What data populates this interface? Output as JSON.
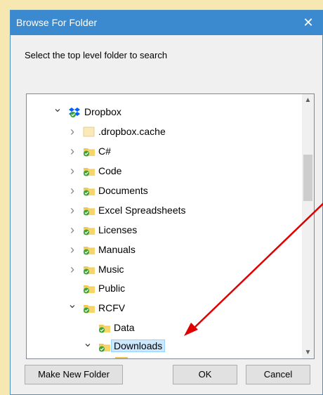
{
  "dialog": {
    "title": "Browse For Folder",
    "close_symbol": "✕",
    "instruction": "Select the top level folder to search"
  },
  "tree": {
    "items": [
      {
        "label": "Dropbox",
        "expander": "expanded",
        "icon": "dropbox-icon"
      },
      {
        "label": ".dropbox.cache",
        "expander": "collapsed",
        "icon": "folder-plain-icon"
      },
      {
        "label": "C#",
        "expander": "collapsed",
        "icon": "folder-synced-icon"
      },
      {
        "label": "Code",
        "expander": "collapsed",
        "icon": "folder-synced-icon"
      },
      {
        "label": "Documents",
        "expander": "collapsed",
        "icon": "folder-synced-icon"
      },
      {
        "label": "Excel Spreadsheets",
        "expander": "collapsed",
        "icon": "folder-synced-icon"
      },
      {
        "label": "Licenses",
        "expander": "collapsed",
        "icon": "folder-synced-icon"
      },
      {
        "label": "Manuals",
        "expander": "collapsed",
        "icon": "folder-synced-icon"
      },
      {
        "label": "Music",
        "expander": "collapsed",
        "icon": "folder-synced-icon"
      },
      {
        "label": "Public",
        "expander": "none",
        "icon": "folder-synced-icon"
      },
      {
        "label": "RCFV",
        "expander": "expanded",
        "icon": "folder-synced-icon"
      },
      {
        "label": "Data",
        "expander": "none",
        "icon": "folder-synced-icon"
      },
      {
        "label": "Downloads",
        "expander": "expanded",
        "icon": "folder-synced-icon",
        "selected": true
      }
    ]
  },
  "buttons": {
    "make_new_folder": "Make New Folder",
    "ok": "OK",
    "cancel": "Cancel"
  },
  "colors": {
    "titlebar": "#3b8ad0",
    "background": "#f7e7b0",
    "selection": "#cce8ff",
    "annotation_arrow": "#e00000",
    "folder": "#f0c850",
    "sync_badge": "#3aa335"
  }
}
